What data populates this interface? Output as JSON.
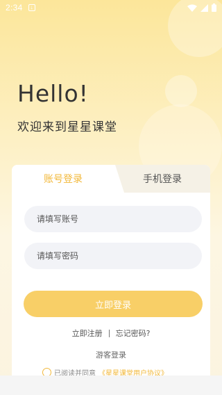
{
  "status_bar": {
    "time": "2:34",
    "notification_icon": "download-icon",
    "icons": [
      "wifi-icon",
      "signal-icon",
      "battery-icon"
    ]
  },
  "greeting": {
    "title": "Hello!",
    "subtitle": "欢迎来到星星课堂"
  },
  "tabs": {
    "account_login": "账号登录",
    "phone_login": "手机登录",
    "active": "account_login"
  },
  "form": {
    "account_placeholder": "请填写账号",
    "account_value": "",
    "password_placeholder": "请填写密码",
    "password_value": "",
    "login_button": "立即登录"
  },
  "links": {
    "register": "立即注册",
    "forgot_password": "忘记密码?",
    "guest_login": "游客登录"
  },
  "agreement": {
    "prefix": "已阅读并同意",
    "link": "《星星课堂用户协议》",
    "checked": false
  },
  "colors": {
    "accent": "#f2b83a",
    "button": "#f8cf67",
    "background_top": "#fce69a"
  }
}
